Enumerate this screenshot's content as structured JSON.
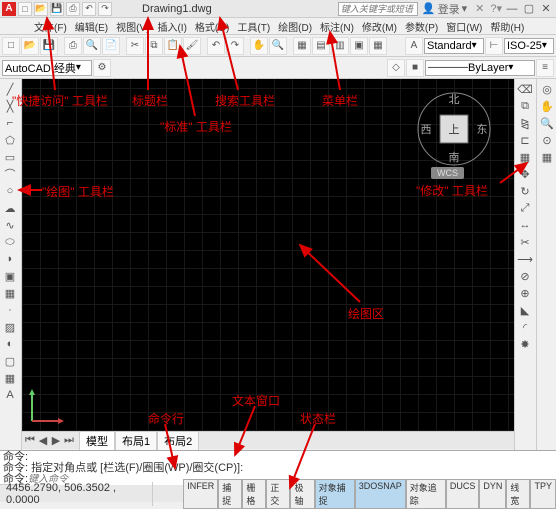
{
  "title": "Drawing1.dwg",
  "search_placeholder": "键入关键字或短语",
  "login_label": "登录",
  "menus": [
    "文件(F)",
    "编辑(E)",
    "视图(V)",
    "插入(I)",
    "格式(O)",
    "工具(T)",
    "绘图(D)",
    "标注(N)",
    "修改(M)",
    "参数(P)",
    "窗口(W)",
    "帮助(H)"
  ],
  "workspace": "AutoCAD 经典",
  "style_combo": "Standard",
  "iso_combo": "ISO-25",
  "layer_combo": "ByLayer",
  "wcs": "WCS",
  "tabs": {
    "model": "模型",
    "layout1": "布局1",
    "layout2": "布局2"
  },
  "cmd_history1": "命令:",
  "cmd_history2": "命令: 指定对角点或 [栏选(F)/圈围(WP)/圈交(CP)]:",
  "cmd_prompt": "命令:",
  "cmd_placeholder": "键入命令",
  "coords": "4456.2790, 506.3502 , 0.0000",
  "status_btns": [
    "INFER",
    "捕捉",
    "栅格",
    "正交",
    "极轴",
    "对象捕捉",
    "3DOSNAP",
    "对象追踪",
    "DUCS",
    "DYN",
    "线宽",
    "TPY"
  ],
  "viewcube": {
    "n": "北",
    "s": "南",
    "e": "东",
    "w": "西",
    "top": "上"
  },
  "annotations": {
    "qat": "\"快捷访问\" 工具栏",
    "titlebar": "标题栏",
    "search": "搜索工具栏",
    "menubar": "菜单栏",
    "standard": "\"标准\" 工具栏",
    "draw": "\"绘图\" 工具栏",
    "modify": "\"修改\" 工具栏",
    "canvas": "绘图区",
    "textwin": "文本窗口",
    "cmdline": "命令行",
    "statusbar": "状态栏"
  }
}
